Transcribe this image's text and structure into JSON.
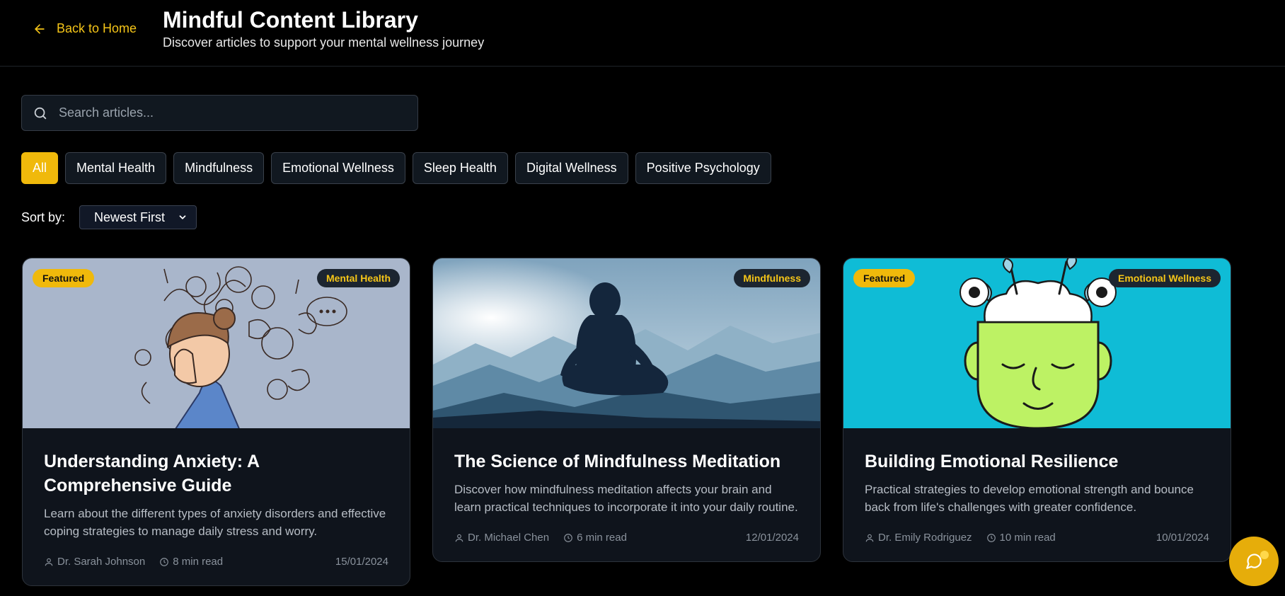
{
  "header": {
    "back_label": "Back to Home",
    "title": "Mindful Content Library",
    "subtitle": "Discover articles to support your mental wellness journey"
  },
  "search": {
    "placeholder": "Search articles...",
    "value": ""
  },
  "filters": [
    "All",
    "Mental Health",
    "Mindfulness",
    "Emotional Wellness",
    "Sleep Health",
    "Digital Wellness",
    "Positive Psychology"
  ],
  "active_filter": "All",
  "sort": {
    "label": "Sort by:",
    "selected": "Newest First"
  },
  "articles": [
    {
      "featured_label": "Featured",
      "category": "Mental Health",
      "title": "Understanding Anxiety: A Comprehensive Guide",
      "description": "Learn about the different types of anxiety disorders and effective coping strategies to manage daily stress and worry.",
      "author": "Dr. Sarah Johnson",
      "read_time": "8 min read",
      "date": "15/01/2024"
    },
    {
      "featured_label": "",
      "category": "Mindfulness",
      "title": "The Science of Mindfulness Meditation",
      "description": "Discover how mindfulness meditation affects your brain and learn practical techniques to incorporate it into your daily routine.",
      "author": "Dr. Michael Chen",
      "read_time": "6 min read",
      "date": "12/01/2024"
    },
    {
      "featured_label": "Featured",
      "category": "Emotional Wellness",
      "title": "Building Emotional Resilience",
      "description": "Practical strategies to develop emotional strength and bounce back from life's challenges with greater confidence.",
      "author": "Dr. Emily Rodriguez",
      "read_time": "10 min read",
      "date": "10/01/2024"
    }
  ],
  "colors": {
    "accent": "#f0b90b",
    "background": "#000000",
    "card": "#0f141c"
  }
}
